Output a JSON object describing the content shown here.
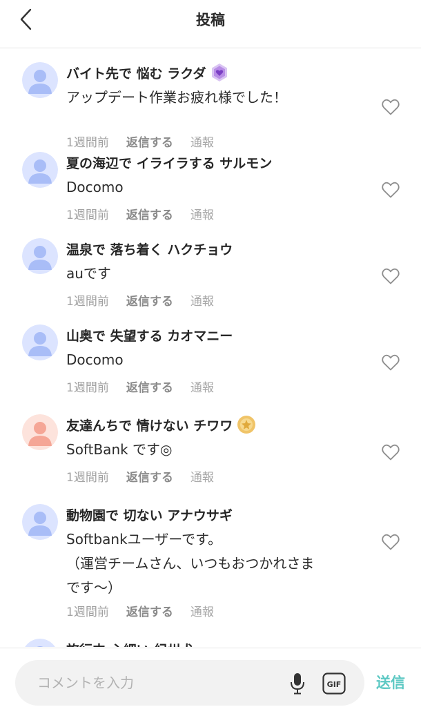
{
  "header": {
    "title": "投稿",
    "back_icon": "chevron-left-icon"
  },
  "comments": [
    {
      "name": "バイト先で 悩む ラクダ",
      "avatar": "avatar-blue",
      "badge": "purple-heart-badge",
      "text_lines": [
        "アップデート作業お疲れ様でした！"
      ],
      "time": "1週間前",
      "reply": "返信する",
      "report": "通報"
    },
    {
      "name": "夏の海辺で イライラする サルモン",
      "avatar": "avatar-blue",
      "badge": "",
      "text_lines": [
        "Docomo"
      ],
      "time": "1週間前",
      "reply": "返信する",
      "report": "通報"
    },
    {
      "name": "温泉で 落ち着く ハクチョウ",
      "avatar": "avatar-blue",
      "badge": "",
      "text_lines": [
        "auです"
      ],
      "time": "1週間前",
      "reply": "返信する",
      "report": "通報"
    },
    {
      "name": "山奥で 失望する カオマニー",
      "avatar": "avatar-blue",
      "badge": "",
      "text_lines": [
        "Docomo"
      ],
      "time": "1週間前",
      "reply": "返信する",
      "report": "通報"
    },
    {
      "name": "友達んちで 情けない チワワ",
      "avatar": "avatar-pink",
      "badge": "gold-star-badge",
      "text_lines": [
        "SoftBank です◎"
      ],
      "time": "1週間前",
      "reply": "返信する",
      "report": "通報"
    },
    {
      "name": "動物園で 切ない アナウサギ",
      "avatar": "avatar-blue",
      "badge": "",
      "text_lines": [
        "Softbankユーザーです。",
        "（運営チームさん、いつもおつかれさま",
        "です〜）"
      ],
      "time": "1週間前",
      "reply": "返信する",
      "report": "通報"
    },
    {
      "name": "旅行中 心細い 紀州犬",
      "avatar": "avatar-blue",
      "badge": "",
      "text_lines": [],
      "time": "",
      "reply": "",
      "report": ""
    }
  ],
  "composer": {
    "placeholder": "コメントを入力",
    "mic_icon": "microphone-icon",
    "gif_icon": "gif-icon",
    "send_label": "送信"
  },
  "colors": {
    "avatar_blue_bg": "#dce4ff",
    "avatar_blue_fg": "#a9bdf7",
    "avatar_pink_bg": "#fde3dc",
    "avatar_pink_fg": "#f5a696",
    "send": "#5cc8c3",
    "badge_purple": "#b88de6",
    "badge_gold": "#f0c468"
  }
}
